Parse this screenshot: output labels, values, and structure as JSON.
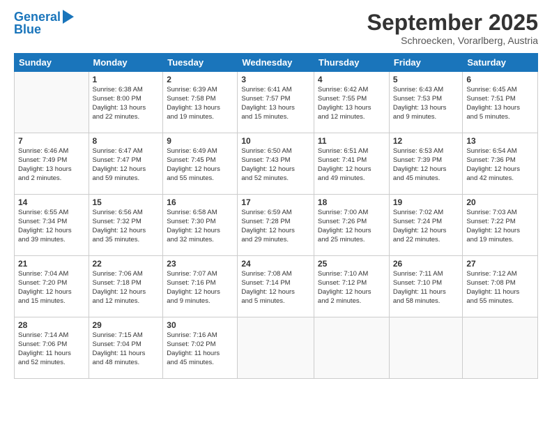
{
  "header": {
    "logo_line1": "General",
    "logo_line2": "Blue",
    "month_title": "September 2025",
    "subtitle": "Schroecken, Vorarlberg, Austria"
  },
  "weekdays": [
    "Sunday",
    "Monday",
    "Tuesday",
    "Wednesday",
    "Thursday",
    "Friday",
    "Saturday"
  ],
  "weeks": [
    [
      {
        "day": "",
        "info": ""
      },
      {
        "day": "1",
        "info": "Sunrise: 6:38 AM\nSunset: 8:00 PM\nDaylight: 13 hours\nand 22 minutes."
      },
      {
        "day": "2",
        "info": "Sunrise: 6:39 AM\nSunset: 7:58 PM\nDaylight: 13 hours\nand 19 minutes."
      },
      {
        "day": "3",
        "info": "Sunrise: 6:41 AM\nSunset: 7:57 PM\nDaylight: 13 hours\nand 15 minutes."
      },
      {
        "day": "4",
        "info": "Sunrise: 6:42 AM\nSunset: 7:55 PM\nDaylight: 13 hours\nand 12 minutes."
      },
      {
        "day": "5",
        "info": "Sunrise: 6:43 AM\nSunset: 7:53 PM\nDaylight: 13 hours\nand 9 minutes."
      },
      {
        "day": "6",
        "info": "Sunrise: 6:45 AM\nSunset: 7:51 PM\nDaylight: 13 hours\nand 5 minutes."
      }
    ],
    [
      {
        "day": "7",
        "info": "Sunrise: 6:46 AM\nSunset: 7:49 PM\nDaylight: 13 hours\nand 2 minutes."
      },
      {
        "day": "8",
        "info": "Sunrise: 6:47 AM\nSunset: 7:47 PM\nDaylight: 12 hours\nand 59 minutes."
      },
      {
        "day": "9",
        "info": "Sunrise: 6:49 AM\nSunset: 7:45 PM\nDaylight: 12 hours\nand 55 minutes."
      },
      {
        "day": "10",
        "info": "Sunrise: 6:50 AM\nSunset: 7:43 PM\nDaylight: 12 hours\nand 52 minutes."
      },
      {
        "day": "11",
        "info": "Sunrise: 6:51 AM\nSunset: 7:41 PM\nDaylight: 12 hours\nand 49 minutes."
      },
      {
        "day": "12",
        "info": "Sunrise: 6:53 AM\nSunset: 7:39 PM\nDaylight: 12 hours\nand 45 minutes."
      },
      {
        "day": "13",
        "info": "Sunrise: 6:54 AM\nSunset: 7:36 PM\nDaylight: 12 hours\nand 42 minutes."
      }
    ],
    [
      {
        "day": "14",
        "info": "Sunrise: 6:55 AM\nSunset: 7:34 PM\nDaylight: 12 hours\nand 39 minutes."
      },
      {
        "day": "15",
        "info": "Sunrise: 6:56 AM\nSunset: 7:32 PM\nDaylight: 12 hours\nand 35 minutes."
      },
      {
        "day": "16",
        "info": "Sunrise: 6:58 AM\nSunset: 7:30 PM\nDaylight: 12 hours\nand 32 minutes."
      },
      {
        "day": "17",
        "info": "Sunrise: 6:59 AM\nSunset: 7:28 PM\nDaylight: 12 hours\nand 29 minutes."
      },
      {
        "day": "18",
        "info": "Sunrise: 7:00 AM\nSunset: 7:26 PM\nDaylight: 12 hours\nand 25 minutes."
      },
      {
        "day": "19",
        "info": "Sunrise: 7:02 AM\nSunset: 7:24 PM\nDaylight: 12 hours\nand 22 minutes."
      },
      {
        "day": "20",
        "info": "Sunrise: 7:03 AM\nSunset: 7:22 PM\nDaylight: 12 hours\nand 19 minutes."
      }
    ],
    [
      {
        "day": "21",
        "info": "Sunrise: 7:04 AM\nSunset: 7:20 PM\nDaylight: 12 hours\nand 15 minutes."
      },
      {
        "day": "22",
        "info": "Sunrise: 7:06 AM\nSunset: 7:18 PM\nDaylight: 12 hours\nand 12 minutes."
      },
      {
        "day": "23",
        "info": "Sunrise: 7:07 AM\nSunset: 7:16 PM\nDaylight: 12 hours\nand 9 minutes."
      },
      {
        "day": "24",
        "info": "Sunrise: 7:08 AM\nSunset: 7:14 PM\nDaylight: 12 hours\nand 5 minutes."
      },
      {
        "day": "25",
        "info": "Sunrise: 7:10 AM\nSunset: 7:12 PM\nDaylight: 12 hours\nand 2 minutes."
      },
      {
        "day": "26",
        "info": "Sunrise: 7:11 AM\nSunset: 7:10 PM\nDaylight: 11 hours\nand 58 minutes."
      },
      {
        "day": "27",
        "info": "Sunrise: 7:12 AM\nSunset: 7:08 PM\nDaylight: 11 hours\nand 55 minutes."
      }
    ],
    [
      {
        "day": "28",
        "info": "Sunrise: 7:14 AM\nSunset: 7:06 PM\nDaylight: 11 hours\nand 52 minutes."
      },
      {
        "day": "29",
        "info": "Sunrise: 7:15 AM\nSunset: 7:04 PM\nDaylight: 11 hours\nand 48 minutes."
      },
      {
        "day": "30",
        "info": "Sunrise: 7:16 AM\nSunset: 7:02 PM\nDaylight: 11 hours\nand 45 minutes."
      },
      {
        "day": "",
        "info": ""
      },
      {
        "day": "",
        "info": ""
      },
      {
        "day": "",
        "info": ""
      },
      {
        "day": "",
        "info": ""
      }
    ]
  ]
}
